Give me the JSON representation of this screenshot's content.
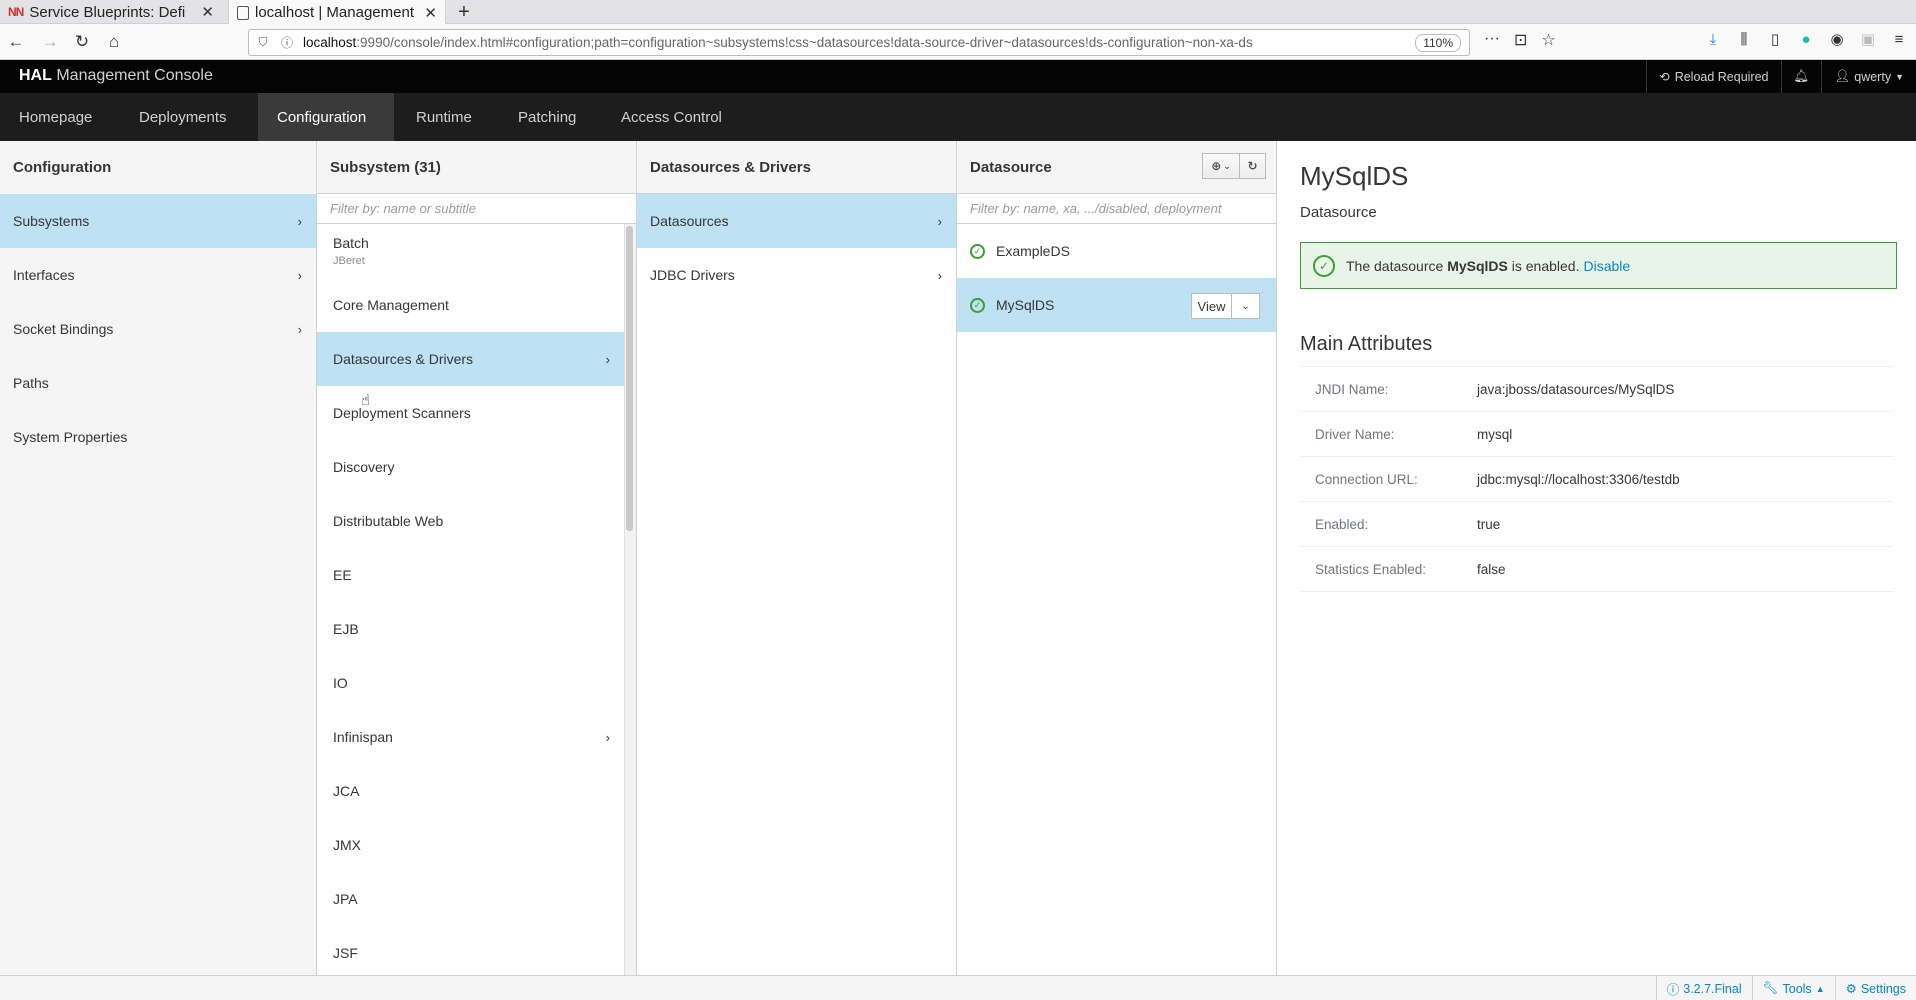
{
  "browser": {
    "tabs": [
      {
        "label": "Service Blueprints: Defi",
        "favicon": "NN"
      },
      {
        "label": "localhost | Management",
        "active": true
      }
    ],
    "url": {
      "host": "localhost",
      "rest": ":9990/console/index.html#configuration;path=configuration~subsystems!css~datasources!data-source-driver~datasources!ds-configuration~non-xa-ds"
    },
    "zoom": "110%"
  },
  "header": {
    "brand_bold": "HAL",
    "brand_light": "Management Console",
    "reload": "Reload Required",
    "user": "qwerty"
  },
  "mainnav": {
    "items": [
      "Homepage",
      "Deployments",
      "Configuration",
      "Runtime",
      "Patching",
      "Access Control"
    ],
    "active": "Configuration"
  },
  "col1": {
    "title": "Configuration",
    "items": [
      {
        "label": "Subsystems",
        "chevron": true,
        "selected": true
      },
      {
        "label": "Interfaces",
        "chevron": true
      },
      {
        "label": "Socket Bindings",
        "chevron": true
      },
      {
        "label": "Paths"
      },
      {
        "label": "System Properties"
      }
    ]
  },
  "col2": {
    "title": "Subsystem (31)",
    "filter_placeholder": "Filter by: name or subtitle",
    "items": [
      {
        "label": "Batch",
        "sub": "JBeret"
      },
      {
        "label": "Core Management"
      },
      {
        "label": "Datasources & Drivers",
        "chevron": true,
        "selected": true
      },
      {
        "label": "Deployment Scanners"
      },
      {
        "label": "Discovery"
      },
      {
        "label": "Distributable Web"
      },
      {
        "label": "EE"
      },
      {
        "label": "EJB"
      },
      {
        "label": "IO"
      },
      {
        "label": "Infinispan",
        "chevron": true
      },
      {
        "label": "JCA"
      },
      {
        "label": "JMX"
      },
      {
        "label": "JPA"
      },
      {
        "label": "JSF"
      }
    ]
  },
  "col3": {
    "title": "Datasources & Drivers",
    "items": [
      {
        "label": "Datasources",
        "chevron": true,
        "selected": true
      },
      {
        "label": "JDBC Drivers",
        "chevron": true
      }
    ]
  },
  "col4": {
    "title": "Datasource",
    "filter_placeholder": "Filter by: name, xa, .../disabled, deployment",
    "items": [
      {
        "label": "ExampleDS"
      },
      {
        "label": "MySqlDS",
        "selected": true
      }
    ],
    "view_label": "View"
  },
  "preview": {
    "title": "MySqlDS",
    "subtitle": "Datasource",
    "alert_pre": "The datasource",
    "alert_name": "MySqlDS",
    "alert_post": "is enabled.",
    "alert_link": "Disable",
    "section": "Main Attributes",
    "attributes": [
      {
        "key": "JNDI Name:",
        "value": "java:jboss/datasources/MySqlDS"
      },
      {
        "key": "Driver Name:",
        "value": "mysql"
      },
      {
        "key": "Connection URL:",
        "value": "jdbc:mysql://localhost:3306/testdb"
      },
      {
        "key": "Enabled:",
        "value": "true"
      },
      {
        "key": "Statistics Enabled:",
        "value": "false"
      }
    ]
  },
  "footer": {
    "version": "3.2.7.Final",
    "tools": "Tools",
    "settings": "Settings"
  }
}
